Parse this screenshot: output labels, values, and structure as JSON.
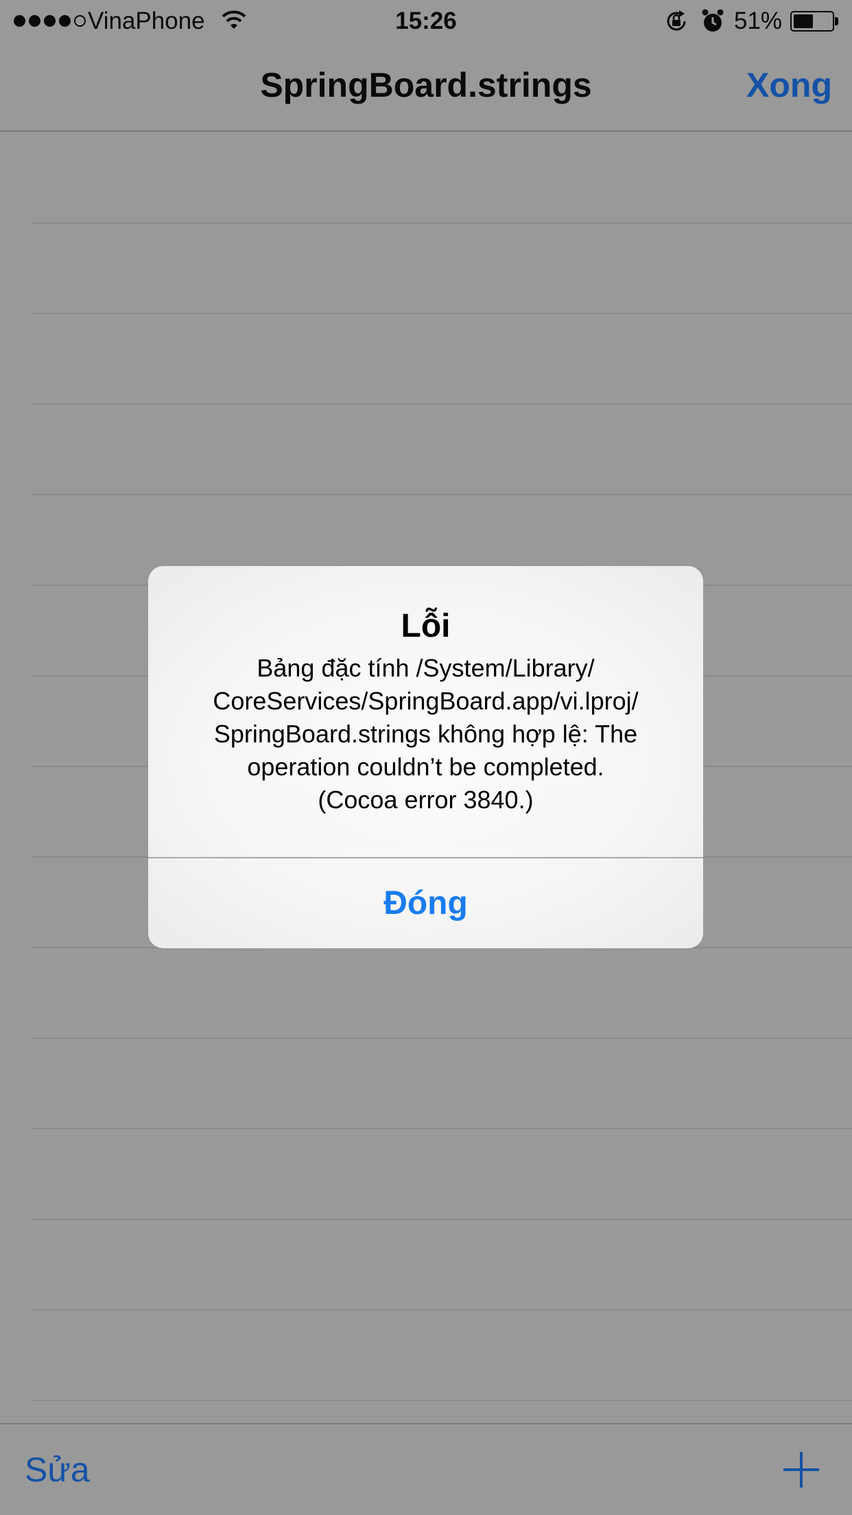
{
  "status_bar": {
    "signal_bars": [
      true,
      true,
      true,
      true,
      false
    ],
    "carrier": "VinaPhone",
    "time": "15:26",
    "battery_percent": "51%",
    "battery_level": 0.51,
    "icons": [
      "signal-icon",
      "wifi-icon",
      "rotation-lock-icon",
      "alarm-icon",
      "battery-icon"
    ]
  },
  "nav_bar": {
    "title": "SpringBoard.strings",
    "done_label": "Xong"
  },
  "toolbar": {
    "edit_label": "Sửa",
    "add_icon": "plus-icon"
  },
  "alert": {
    "title": "Lỗi",
    "message_lines": [
      "Bảng đặc tính /System/Library/",
      "CoreServices/SpringBoard.app/vi.lproj/",
      "SpringBoard.strings không hợp lệ: The",
      "operation couldn’t be completed.",
      "(Cocoa error 3840.)"
    ],
    "button_label": "Đóng"
  },
  "colors": {
    "background_dim": "#999999",
    "tint_dimmed": "#1552a6",
    "alert_button": "#1a7cf0",
    "alert_background": "#f7f7f7"
  }
}
